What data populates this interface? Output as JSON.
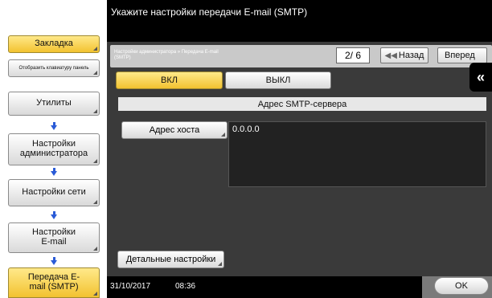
{
  "header": {
    "title": "Укажите настройки передачи E-mail (SMTP)"
  },
  "sidebar": {
    "bookmark_label": "Закладка",
    "keypad_label": "Отобразить клавиатуру панель",
    "path": [
      {
        "label": "Утилиты"
      },
      {
        "label": "Настройки администратора"
      },
      {
        "label": "Настройки сети"
      },
      {
        "label": "Настройки E-mail"
      },
      {
        "label": "Передача E-mail (SMTP)"
      }
    ]
  },
  "toolbar": {
    "breadcrumb": "Настройки администратора » Передача E-mail (SMTP)",
    "page_indicator": "2/ 6",
    "back_label": "Назад",
    "forward_label": "Вперед"
  },
  "toggle": {
    "on_label": "ВКЛ",
    "off_label": "ВЫКЛ",
    "selected": "ВКЛ"
  },
  "smtp": {
    "section_title": "Адрес SMTP-сервера",
    "host_button_label": "Адрес хоста",
    "host_value": "0.0.0.0"
  },
  "detail_button_label": "Детальные настройки",
  "status": {
    "date": "31/10/2017",
    "time": "08:36"
  },
  "ok_label": "OK",
  "collapse_icon": "double-chevron-left-icon",
  "colors": {
    "selected_yellow": "#f2c230",
    "panel_dark": "#3a3a3a"
  }
}
